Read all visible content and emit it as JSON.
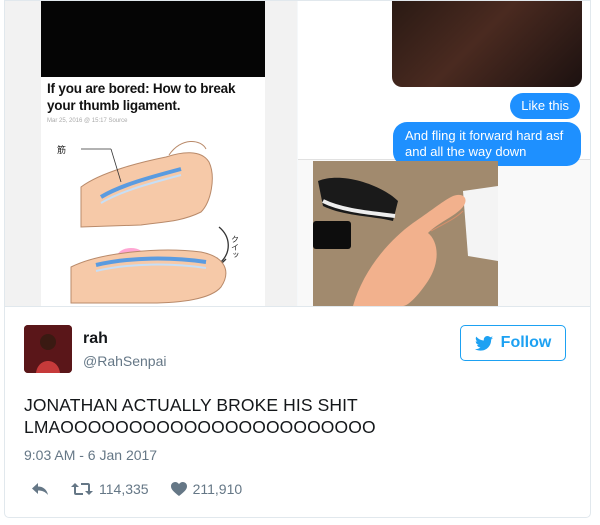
{
  "media": {
    "article_title": "If you are bored: How to break your thumb ligament.",
    "article_meta": "Mar 25, 2016 @ 15:17  Source",
    "illustration_label_top": "筋",
    "illustration_label_side": "クイッ",
    "chat": {
      "bubble_1": "Like this",
      "bubble_2": "And fling it forward hard asf and all the way down"
    }
  },
  "tweet": {
    "display_name": "rah",
    "handle": "@RahSenpai",
    "follow_label": "Follow",
    "text_line_1": "JONATHAN ACTUALLY BROKE HIS SHIT",
    "text_line_2": "LMAOOOOOOOOOOOOOOOOOOOOOOO",
    "timestamp": "9:03 AM - 6 Jan 2017",
    "retweets": "114,335",
    "likes": "211,910"
  },
  "colors": {
    "accent": "#1da1f2",
    "imessage": "#1e90ff",
    "muted": "#657786"
  }
}
